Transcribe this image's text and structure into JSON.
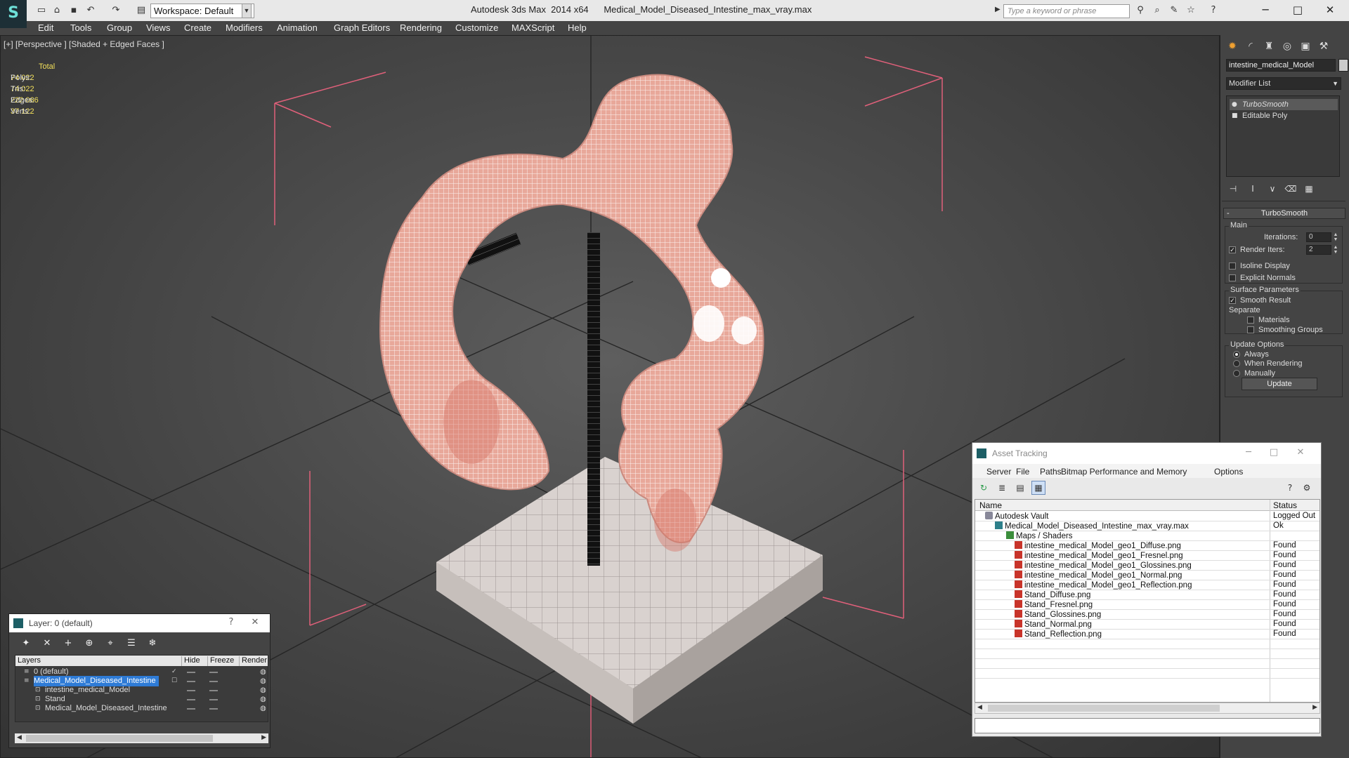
{
  "titlebar": {
    "workspace_label": "Workspace: Default",
    "app_title": "Autodesk 3ds Max  2014 x64",
    "file_title": "Medical_Model_Diseased_Intestine_max_vray.max",
    "search_placeholder": "Type a keyword or phrase"
  },
  "menu": [
    "Edit",
    "Tools",
    "Group",
    "Views",
    "Create",
    "Modifiers",
    "Animation",
    "Graph Editors",
    "Rendering",
    "Customize",
    "MAXScript",
    "Help"
  ],
  "viewport": {
    "label": "[+] [Perspective ] [Shaded + Edged Faces ]",
    "stats_header": "Total",
    "stats": [
      {
        "label": "Polys:",
        "value": "74 022"
      },
      {
        "label": "Tris:",
        "value": "74 022"
      },
      {
        "label": "Edges:",
        "value": "222 066"
      },
      {
        "label": "Verts:",
        "value": "37 122"
      }
    ]
  },
  "command_panel": {
    "object_name": "intestine_medical_Model",
    "modifier_list": "Modifier List",
    "stack": [
      "TurboSmooth",
      "Editable Poly"
    ],
    "rollout_title": "TurboSmooth",
    "main_group": "Main",
    "iterations_label": "Iterations:",
    "iterations_value": "0",
    "render_iters_label": "Render Iters:",
    "render_iters_value": "2",
    "render_iters_checked": true,
    "isoline_label": "Isoline Display",
    "explicit_normals_label": "Explicit Normals",
    "surface_group": "Surface Parameters",
    "smooth_result_label": "Smooth Result",
    "separate_label": "Separate",
    "materials_label": "Materials",
    "smoothing_groups_label": "Smoothing Groups",
    "update_group": "Update Options",
    "update_always": "Always",
    "update_when_rendering": "When Rendering",
    "update_manually": "Manually",
    "update_button": "Update"
  },
  "asset_tracking": {
    "title": "Asset Tracking",
    "menu": [
      "Server",
      "File",
      "Paths",
      "Bitmap Performance and Memory",
      "Options"
    ],
    "col_name": "Name",
    "col_status": "Status",
    "rows": [
      {
        "name": "Autodesk Vault",
        "status": "Logged Out",
        "icon": "vault",
        "indent": 0
      },
      {
        "name": "Medical_Model_Diseased_Intestine_max_vray.max",
        "status": "Ok",
        "icon": "max",
        "indent": 1
      },
      {
        "name": "Maps / Shaders",
        "status": "",
        "icon": "maps",
        "indent": 2
      },
      {
        "name": "intestine_medical_Model_geo1_Diffuse.png",
        "status": "Found",
        "icon": "png",
        "indent": 3
      },
      {
        "name": "intestine_medical_Model_geo1_Fresnel.png",
        "status": "Found",
        "icon": "png",
        "indent": 3
      },
      {
        "name": "intestine_medical_Model_geo1_Glossines.png",
        "status": "Found",
        "icon": "png",
        "indent": 3
      },
      {
        "name": "intestine_medical_Model_geo1_Normal.png",
        "status": "Found",
        "icon": "png",
        "indent": 3
      },
      {
        "name": "intestine_medical_Model_geo1_Reflection.png",
        "status": "Found",
        "icon": "png",
        "indent": 3
      },
      {
        "name": "Stand_Diffuse.png",
        "status": "Found",
        "icon": "png",
        "indent": 3
      },
      {
        "name": "Stand_Fresnel.png",
        "status": "Found",
        "icon": "png",
        "indent": 3
      },
      {
        "name": "Stand_Glossines.png",
        "status": "Found",
        "icon": "png",
        "indent": 3
      },
      {
        "name": "Stand_Normal.png",
        "status": "Found",
        "icon": "png",
        "indent": 3
      },
      {
        "name": "Stand_Reflection.png",
        "status": "Found",
        "icon": "png",
        "indent": 3
      }
    ]
  },
  "layer_manager": {
    "title": "Layer: 0 (default)",
    "col_layers": "Layers",
    "col_hide": "Hide",
    "col_freeze": "Freeze",
    "col_render": "Render",
    "rows": [
      {
        "name": "0 (default)",
        "level": 0,
        "selected": false,
        "current": true
      },
      {
        "name": "Medical_Model_Diseased_Intestine",
        "level": 0,
        "selected": true,
        "current": false
      },
      {
        "name": "intestine_medical_Model",
        "level": 1,
        "selected": false,
        "current": false
      },
      {
        "name": "Stand",
        "level": 1,
        "selected": false,
        "current": false
      },
      {
        "name": "Medical_Model_Diseased_Intestine",
        "level": 1,
        "selected": false,
        "current": false
      }
    ]
  },
  "colors": {
    "stats_text": "#f3e05a",
    "selection_brackets": "#e0607a",
    "intestine_tissue": "#e8a89a",
    "layer_selection": "#2e7bd6"
  }
}
